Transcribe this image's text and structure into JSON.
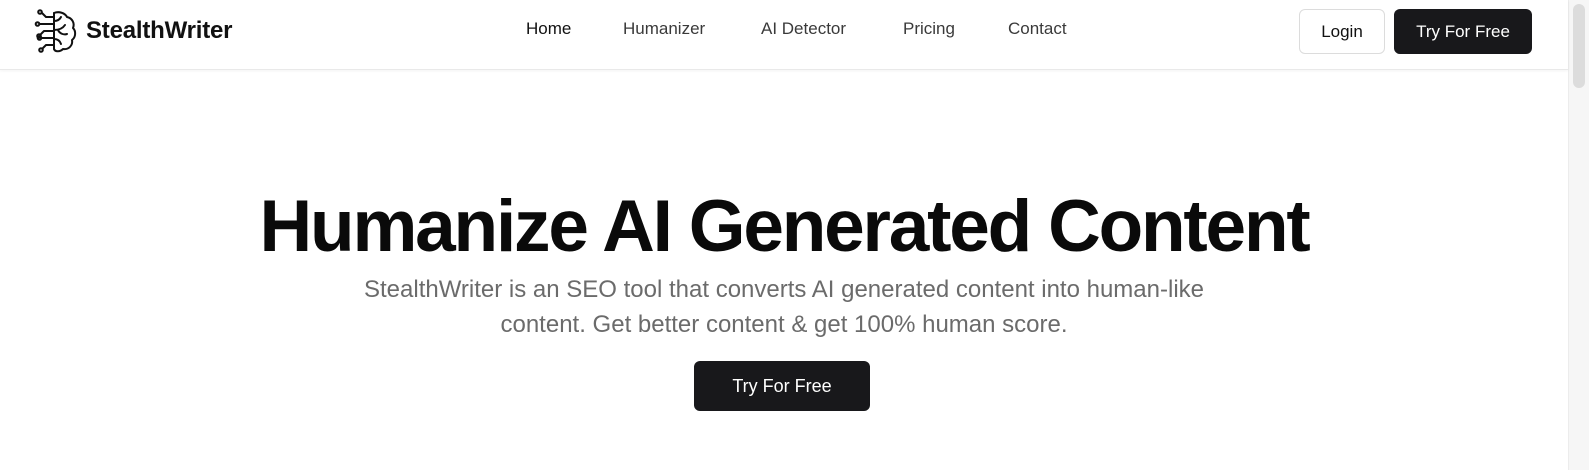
{
  "brand": {
    "name": "StealthWriter",
    "logo_icon": "brain-circuit-icon"
  },
  "nav": {
    "links": [
      {
        "label": "Home"
      },
      {
        "label": "Humanizer"
      },
      {
        "label": "AI Detector"
      },
      {
        "label": "Pricing"
      },
      {
        "label": "Contact"
      }
    ],
    "login_label": "Login",
    "try_label": "Try For Free"
  },
  "hero": {
    "title": "Humanize AI Generated Content",
    "subtitle": "StealthWriter is an SEO tool that converts AI generated content into human-like content. Get better content & get 100% human score.",
    "cta_label": "Try For Free"
  },
  "colors": {
    "primary_button": "#18181b",
    "text": "#111111",
    "subtitle": "#6b6b6b"
  }
}
